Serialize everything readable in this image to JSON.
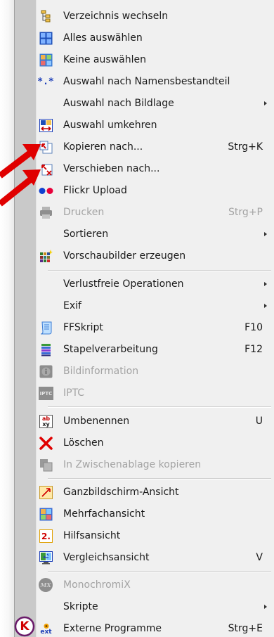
{
  "menu": {
    "items": [
      {
        "label": "Verzeichnis wechseln",
        "shortcut": "",
        "submenu": false,
        "disabled": false,
        "icon": "folder-tree-icon"
      },
      {
        "label": "Alles auswählen",
        "shortcut": "",
        "submenu": false,
        "disabled": false,
        "icon": "select-all-icon"
      },
      {
        "label": "Keine auswählen",
        "shortcut": "",
        "submenu": false,
        "disabled": false,
        "icon": "select-none-icon"
      },
      {
        "label": "Auswahl nach Namensbestandteil",
        "shortcut": "",
        "submenu": false,
        "disabled": false,
        "icon": "wildcard-icon"
      },
      {
        "label": "Auswahl nach Bildlage",
        "shortcut": "",
        "submenu": true,
        "disabled": false,
        "icon": ""
      },
      {
        "label": "Auswahl umkehren",
        "shortcut": "",
        "submenu": false,
        "disabled": false,
        "icon": "invert-selection-icon"
      },
      {
        "label": "Kopieren nach...",
        "shortcut": "Strg+K",
        "submenu": false,
        "disabled": false,
        "icon": "copy-to-icon"
      },
      {
        "label": "Verschieben nach...",
        "shortcut": "",
        "submenu": false,
        "disabled": false,
        "icon": "move-to-icon"
      },
      {
        "label": "Flickr Upload",
        "shortcut": "",
        "submenu": false,
        "disabled": false,
        "icon": "flickr-icon"
      },
      {
        "label": "Drucken",
        "shortcut": "Strg+P",
        "submenu": false,
        "disabled": true,
        "icon": "printer-icon"
      },
      {
        "label": "Sortieren",
        "shortcut": "",
        "submenu": true,
        "disabled": false,
        "icon": ""
      },
      {
        "label": "Vorschaubilder erzeugen",
        "shortcut": "",
        "submenu": false,
        "disabled": false,
        "icon": "thumbnails-icon"
      },
      {
        "label": "Verlustfreie Operationen",
        "shortcut": "",
        "submenu": true,
        "disabled": false,
        "icon": ""
      },
      {
        "label": "Exif",
        "shortcut": "",
        "submenu": true,
        "disabled": false,
        "icon": ""
      },
      {
        "label": "FFSkript",
        "shortcut": "F10",
        "submenu": false,
        "disabled": false,
        "icon": "script-icon"
      },
      {
        "label": "Stapelverarbeitung",
        "shortcut": "F12",
        "submenu": false,
        "disabled": false,
        "icon": "batch-icon"
      },
      {
        "label": "Bildinformation",
        "shortcut": "",
        "submenu": false,
        "disabled": true,
        "icon": "info-icon"
      },
      {
        "label": "IPTC",
        "shortcut": "",
        "submenu": false,
        "disabled": true,
        "icon": "iptc-icon"
      },
      {
        "label": "Umbenennen",
        "shortcut": "U",
        "submenu": false,
        "disabled": false,
        "icon": "rename-icon"
      },
      {
        "label": "Löschen",
        "shortcut": "",
        "submenu": false,
        "disabled": false,
        "icon": "delete-icon"
      },
      {
        "label": "In Zwischenablage kopieren",
        "shortcut": "",
        "submenu": false,
        "disabled": true,
        "icon": "clipboard-icon"
      },
      {
        "label": "Ganzbildschirm-Ansicht",
        "shortcut": "",
        "submenu": false,
        "disabled": false,
        "icon": "fullscreen-icon"
      },
      {
        "label": "Mehrfachansicht",
        "shortcut": "",
        "submenu": false,
        "disabled": false,
        "icon": "multiview-icon"
      },
      {
        "label": "Hilfsansicht",
        "shortcut": "",
        "submenu": false,
        "disabled": false,
        "icon": "secondary-view-icon"
      },
      {
        "label": "Vergleichsansicht",
        "shortcut": "V",
        "submenu": false,
        "disabled": false,
        "icon": "compare-icon"
      },
      {
        "label": "MonochromiX",
        "shortcut": "",
        "submenu": false,
        "disabled": true,
        "icon": "monochromix-icon"
      },
      {
        "label": "Skripte",
        "shortcut": "",
        "submenu": true,
        "disabled": false,
        "icon": ""
      },
      {
        "label": "Externe Programme",
        "shortcut": "Strg+E",
        "submenu": false,
        "disabled": false,
        "icon": "external-programs-icon"
      }
    ],
    "icon_labels": {
      "wildcard": "*.*",
      "iptc": "IPTC",
      "rename_top": "ab",
      "rename_bottom": "xy",
      "secondary_view": "2.",
      "monochromix": "MX",
      "ext": "ext"
    },
    "logo_letter": "K",
    "colors": {
      "menu_bg": "#f0f0f0",
      "gutter": "#c9c9c9",
      "text": "#1a1a1a",
      "disabled_text": "#a3a3a3",
      "accent_red": "#e00000"
    }
  }
}
